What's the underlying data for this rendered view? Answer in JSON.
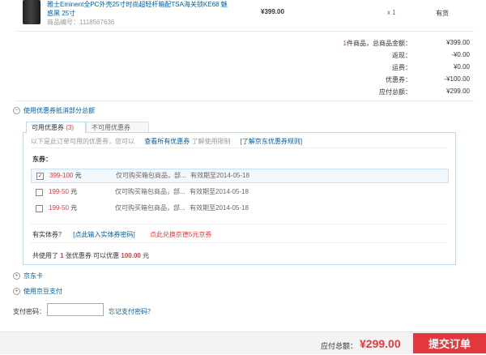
{
  "product": {
    "name_line1": "雅士Eminent全PC外壳25寸时尚超轻杆箱配TSA海关锁KE68 魅",
    "name_line2": "惑黑 25寸",
    "code": "商品编号：1118567636",
    "price": "¥399.00",
    "qty": "x 1",
    "stock": "有货"
  },
  "summary": {
    "items_count": "1",
    "rows": [
      {
        "label_suffix": "件商品，总商品金额：",
        "value": "¥399.00"
      },
      {
        "label": "返现：",
        "value": "-¥0.00"
      },
      {
        "label": "运费：",
        "value": "¥0.00"
      },
      {
        "label": "优惠券：",
        "value": "-¥100.00"
      },
      {
        "label": "应付总额：",
        "value": "¥299.00"
      }
    ]
  },
  "coupon_section": {
    "title": "使用优惠券抵消部分总额",
    "tab_available_label": "可用优惠券",
    "tab_available_count": "(3)",
    "tab_unavailable": "不可用优惠券（6）",
    "hint_prefix": "以下是此订单可用的优惠券，您可以",
    "hint_link": "查看所有优惠券",
    "hint_suffix": "了解使用限制",
    "rules_link": "[了解京东优惠券规则]",
    "group": "东券：",
    "coupons": [
      {
        "amount": "399-100",
        "unit": "元",
        "desc": "仅可购买箱包商品，部...",
        "expiry": "有效期至2014-05-18",
        "checked": "✓"
      },
      {
        "amount": "199-50",
        "unit": "元",
        "desc": "仅可购买箱包商品，部...",
        "expiry": "有效期至2014-05-18",
        "checked": ""
      },
      {
        "amount": "199-50",
        "unit": "元",
        "desc": "仅可购买箱包商品，部...",
        "expiry": "有效期至2014-05-18",
        "checked": ""
      }
    ],
    "physical_label": "有实体券？",
    "physical_link": "[点此输入实体券密码]",
    "exchange_link": "点此兑换京德5元京券",
    "total_prefix": "共使用了",
    "total_count": "1",
    "total_mid": "张优惠券   可以优惠",
    "total_amount": "100.00",
    "total_unit": "元"
  },
  "jdcard": "京东卡",
  "jingdou": "使用京豆支付",
  "pay_pwd": {
    "label": "支付密码：",
    "forgot": "忘记支付密码？"
  },
  "footer": {
    "total_label": "应付总额：",
    "total_value": "¥299.00",
    "submit": "提交订单"
  },
  "colors": {
    "accent": "#e4393c",
    "link": "#005ea7"
  }
}
